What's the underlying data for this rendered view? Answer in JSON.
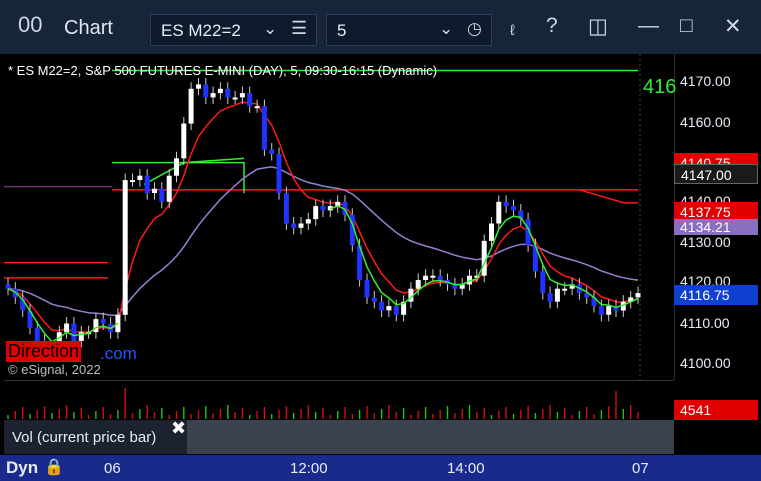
{
  "titlebar": {
    "app_icon_glyph": "00",
    "title": "Chart",
    "symbol": "ES M22=2",
    "interval": "5"
  },
  "chart": {
    "header": "* ES M22=2, S&P 500 FUTURES E-MINI (DAY), 5, 09:30-16:15 (Dynamic)",
    "watermark": "© eSignal, 2022",
    "direction_label": "Direction",
    "direction_suffix": ".com",
    "green_line_label": "416",
    "price_labels": [
      "4170.00",
      "4160.00",
      "4147.00",
      "4140.00",
      "4130.00",
      "4120.00",
      "4110.00",
      "4100.00"
    ],
    "price_tags": {
      "red_top": "4140.75",
      "current_box": "4147.00",
      "red_mid": "4137.75",
      "purple": "4134.21",
      "last": "4116.75"
    },
    "ylim": [
      4097,
      4172
    ],
    "colors": {
      "bull": "#ffffff",
      "bear": "#2233ff",
      "red_line": "#ff1a1a",
      "purple_line": "#9a7fd0",
      "green_line": "#33ee33",
      "last_tag": "#1040d0"
    }
  },
  "chart_data": {
    "type": "line",
    "title": "* ES M22=2, S&P 500 FUTURES E-MINI (DAY), 5, 09:30-16:15 (Dynamic)",
    "x_labels": [
      "06",
      "12:00",
      "14:00",
      "07"
    ],
    "ylim": [
      4097,
      4172
    ],
    "series": [
      {
        "values": [
          4118,
          4116,
          4113,
          4109,
          4106,
          4104,
          4103,
          4108,
          4110,
          4106,
          4108,
          4108,
          4111,
          4110,
          4108,
          4112,
          4143,
          4143,
          4144,
          4140,
          4141,
          4138,
          4144,
          4148,
          4156,
          4164,
          4165,
          4162,
          4163,
          4164,
          4162,
          4162,
          4163,
          4160,
          4160,
          4150,
          4149,
          4140,
          4133,
          4132,
          4133,
          4134,
          4137,
          4136,
          4137,
          4138,
          4135,
          4128,
          4120,
          4116,
          4115,
          4113,
          4114,
          4112,
          4115,
          4118,
          4120,
          4121,
          4121,
          4120,
          4119,
          4118,
          4119,
          4121,
          4121,
          4129,
          4133,
          4138,
          4137,
          4136,
          4134,
          4128,
          4122,
          4117,
          4115,
          4118,
          4118,
          4119,
          4117,
          4116,
          4114,
          4112,
          4114,
          4113,
          4115,
          4116,
          4117
        ]
      }
    ]
  },
  "volume": {
    "label": "Vol (current price bar)",
    "value": "4541"
  },
  "timebar": {
    "mode": "Dyn",
    "labels": [
      "06",
      "12:00",
      "14:00",
      "07"
    ]
  }
}
